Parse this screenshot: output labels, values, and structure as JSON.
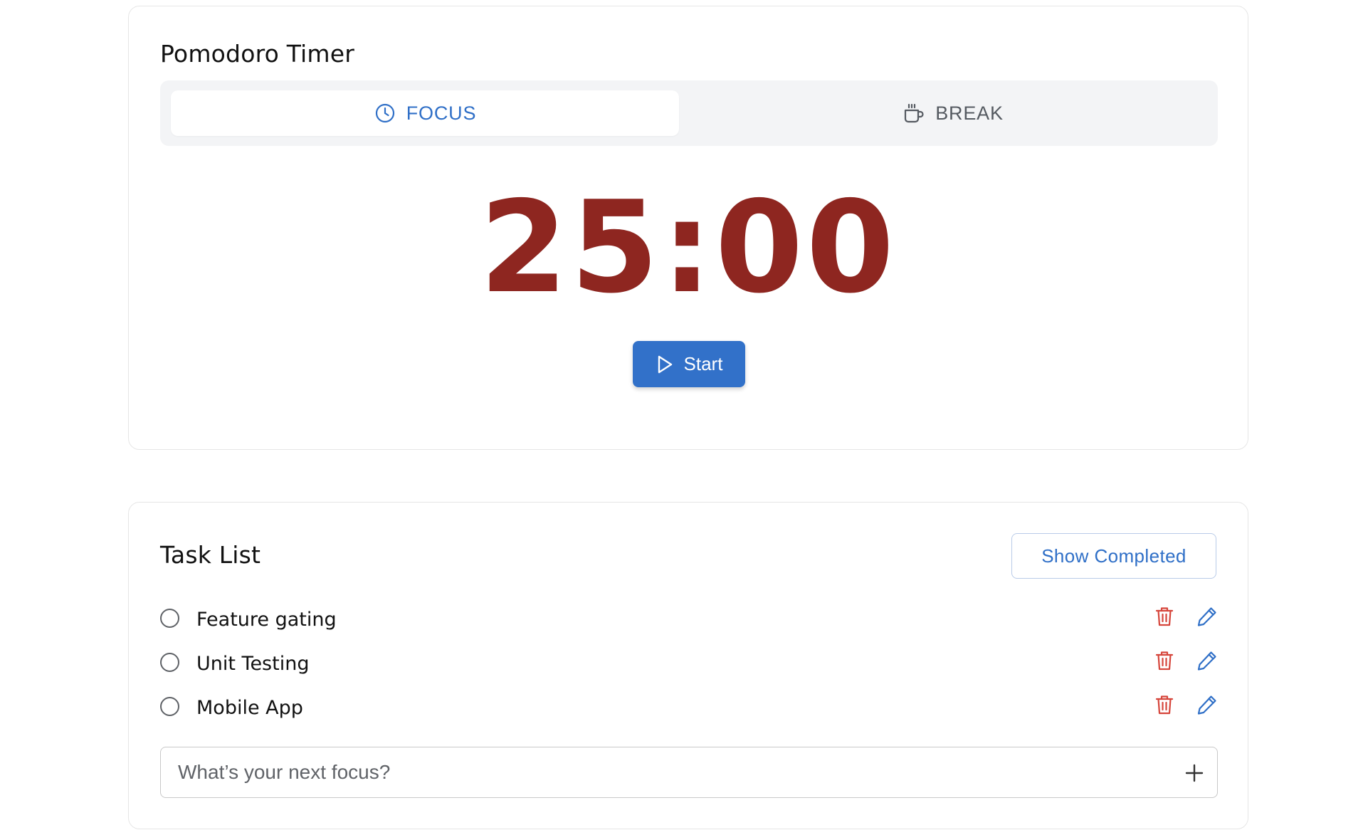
{
  "timer": {
    "title": "Pomodoro Timer",
    "tabs": [
      {
        "label": "FOCUS",
        "icon": "clock-icon",
        "active": true
      },
      {
        "label": "BREAK",
        "icon": "coffee-icon",
        "active": false
      }
    ],
    "time": "25:00",
    "start_label": "Start"
  },
  "tasks": {
    "title": "Task List",
    "show_completed_label": "Show Completed",
    "items": [
      {
        "label": "Feature gating",
        "done": false
      },
      {
        "label": "Unit Testing",
        "done": false
      },
      {
        "label": "Mobile App",
        "done": false
      }
    ],
    "new_task_placeholder": "What’s your next focus?",
    "new_task_value": ""
  },
  "colors": {
    "accent": "#3271c9",
    "time": "#8e2620",
    "delete": "#d6453b",
    "edit": "#2f6fc7"
  }
}
